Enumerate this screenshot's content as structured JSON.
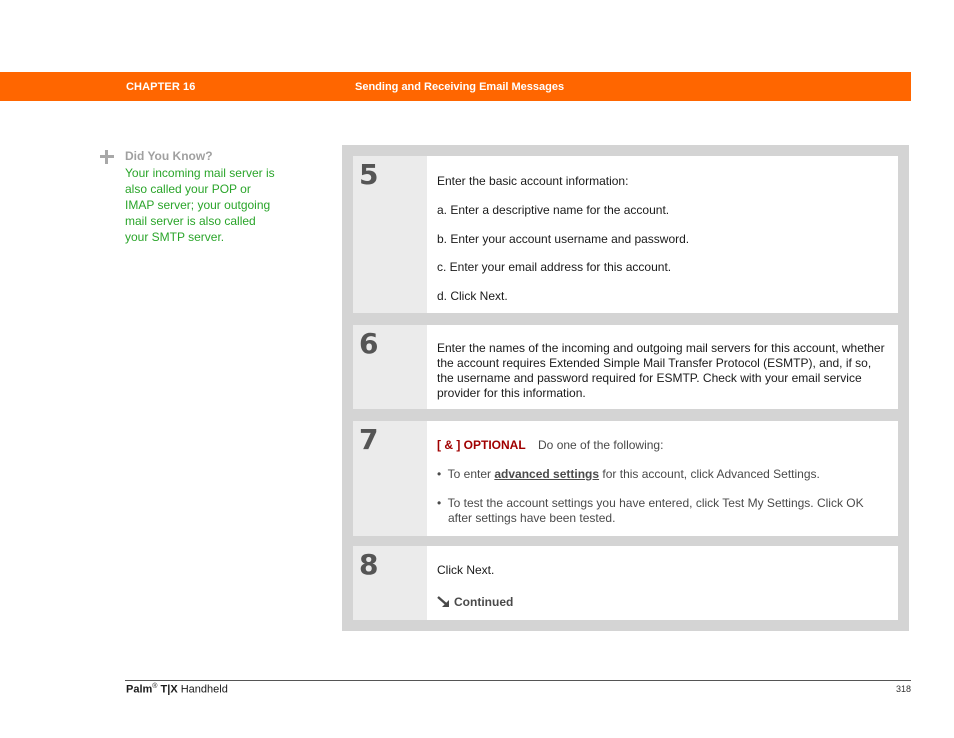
{
  "header": {
    "chapter": "CHAPTER 16",
    "title": "Sending and Receiving Email Messages",
    "color": "#ff6600"
  },
  "tip": {
    "icon": "plus-icon",
    "title": "Did You Know?",
    "body": "Your incoming mail server is also called your POP or IMAP server; your outgoing mail server is also called your SMTP server.",
    "color": "#2aa52a"
  },
  "steps": [
    {
      "number": "5",
      "intro": "Enter the basic account information:",
      "items": [
        "a.  Enter a descriptive name for the account.",
        "b.  Enter your account username and password.",
        "c.  Enter your email address for this account.",
        "d.  Click Next."
      ]
    },
    {
      "number": "6",
      "text": "Enter the names of the incoming and outgoing mail servers for this account, whether the account requires Extended Simple Mail Transfer Protocol (ESMTP), and, if so, the username and password required for ESMTP. Check with your email service provider for this information."
    },
    {
      "number": "7",
      "optional_tag": "[ & ]  OPTIONAL",
      "intro": "Do one of the following:",
      "bullets": [
        {
          "prefix": "To enter ",
          "link": "advanced settings",
          "suffix": " for this account, click Advanced Settings."
        },
        {
          "text": "To test the account settings you have entered, click Test My Settings. Click OK after settings have been tested."
        }
      ],
      "bullet_char": "•"
    },
    {
      "number": "8",
      "text": "Click Next.",
      "continued": "Continued",
      "continued_icon": "arrow-down-right-icon"
    }
  ],
  "footer": {
    "brand": "Palm",
    "registered": "®",
    "model": "T|X",
    "product_suffix": " Handheld",
    "page_number": "318"
  }
}
